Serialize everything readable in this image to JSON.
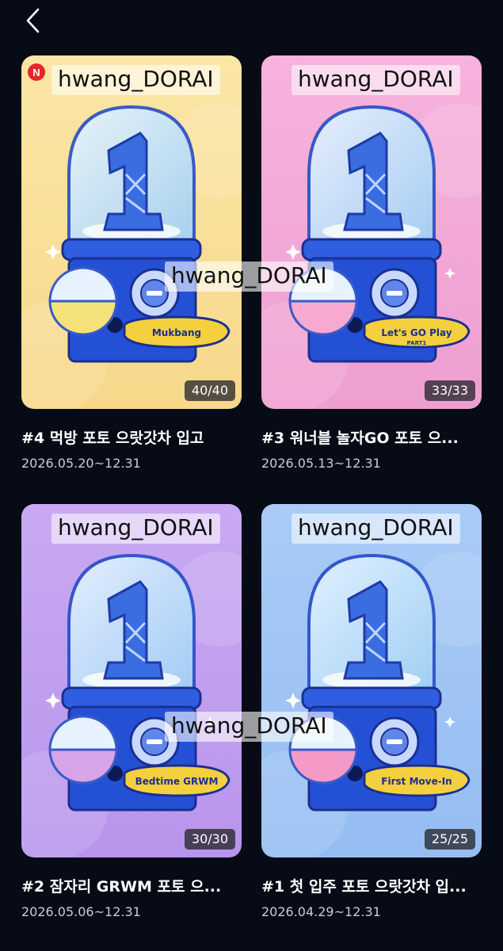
{
  "header": {
    "back_icon": "chevron-left-icon"
  },
  "watermark": "hwang_DORAI",
  "cards": [
    {
      "title": "#4 먹방 포토 으랏갓차 입고",
      "date": "2026.05.20~12.31",
      "count": "40/40",
      "new_badge": "N",
      "capsule_label": "Mukbang",
      "capsule_sublabel": "",
      "bg": "#fbe6a6",
      "bg2": "#f7d88a",
      "capsule_color": "#f5e27a"
    },
    {
      "title": "#3 워너블 놀자GO 포토 으...",
      "date": "2026.05.13~12.31",
      "count": "33/33",
      "new_badge": "",
      "capsule_label": "Let's GO Play",
      "capsule_sublabel": "PART1",
      "bg": "#f6b3dd",
      "bg2": "#ee9fd0",
      "capsule_color": "#f7a9cf"
    },
    {
      "title": "#2 잠자리 GRWM 포토 으...",
      "date": "2026.05.06~12.31",
      "count": "30/30",
      "new_badge": "",
      "capsule_label": "Bedtime GRWM",
      "capsule_sublabel": "",
      "bg": "#c9a9f2",
      "bg2": "#b895ec",
      "capsule_color": "#d8a4e8"
    },
    {
      "title": "#1 첫 입주 포토 으랏갓차 입...",
      "date": "2026.04.29~12.31",
      "count": "25/25",
      "new_badge": "",
      "capsule_label": "First Move-In",
      "capsule_sublabel": "",
      "bg": "#a9cbf6",
      "bg2": "#95bdf2",
      "capsule_color": "#f59ac6"
    }
  ]
}
